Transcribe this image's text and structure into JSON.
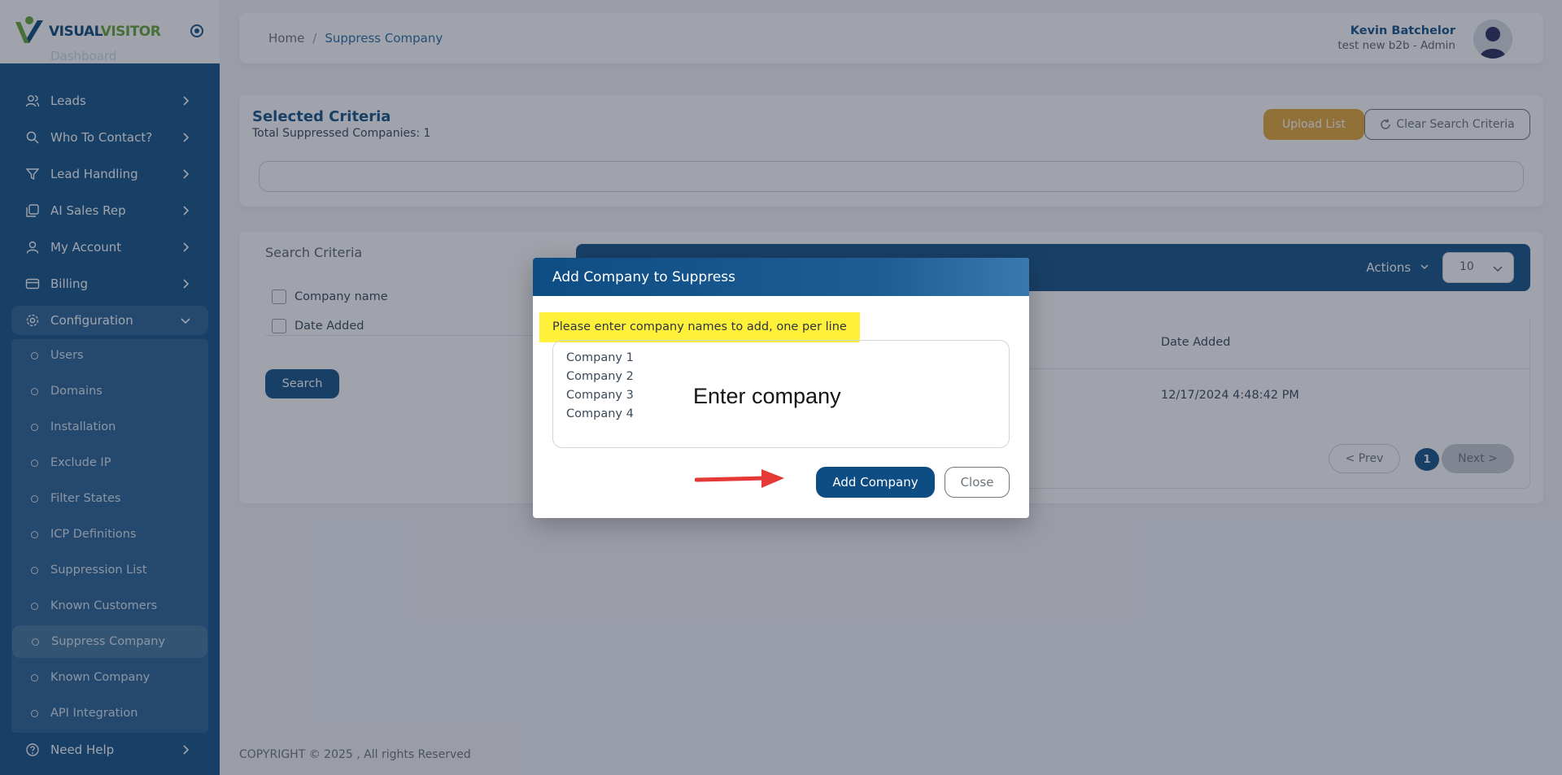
{
  "brand": {
    "part1": "VISUAL",
    "part2": "VISITOR"
  },
  "sidebar": {
    "partial_top_label": "Dashboard",
    "items": [
      {
        "label": "Leads",
        "icon": "users-icon"
      },
      {
        "label": "Who To Contact?",
        "icon": "search-icon"
      },
      {
        "label": "Lead Handling",
        "icon": "filter-icon"
      },
      {
        "label": "AI Sales Rep",
        "icon": "copy-icon"
      },
      {
        "label": "My Account",
        "icon": "user-icon"
      },
      {
        "label": "Billing",
        "icon": "card-icon"
      },
      {
        "label": "Configuration",
        "icon": "gear-icon"
      }
    ],
    "subitems": [
      "Users",
      "Domains",
      "Installation",
      "Exclude IP",
      "Filter States",
      "ICP Definitions",
      "Suppression List",
      "Known Customers",
      "Suppress Company",
      "Known Company",
      "API Integration"
    ],
    "help": "Need Help"
  },
  "header": {
    "breadcrumb_home": "Home",
    "breadcrumb_sep": "/",
    "breadcrumb_current": "Suppress Company",
    "user_name": "Kevin Batchelor",
    "user_role": "test new b2b - Admin"
  },
  "criteria": {
    "title": "Selected Criteria",
    "subtitle": "Total Suppressed Companies: 1",
    "upload_label": "Upload List",
    "clear_label": "Clear Search Criteria"
  },
  "search": {
    "title": "Search Criteria",
    "option_company": "Company name",
    "option_date": "Date Added",
    "search_label": "Search"
  },
  "table": {
    "actions_label": "Actions",
    "page_size": "10",
    "col_date": "Date Added",
    "row_date": "12/17/2024 4:48:42 PM",
    "prev_label": "< Prev",
    "page_num": "1",
    "next_label": "Next >"
  },
  "footer": "COPYRIGHT © 2025 , All rights Reserved",
  "modal": {
    "title": "Add Company to Suppress",
    "hint": "Please enter company names to add, one per line",
    "lines": [
      "Company 1",
      "Company 2",
      "Company 3",
      "Company 4"
    ],
    "annotation": "Enter company",
    "add_label": "Add Company",
    "close_label": "Close"
  },
  "colors": {
    "primary": "#15558b",
    "accent": "#e6a93a",
    "highlight": "#fff03a",
    "arrow": "#e53935"
  }
}
